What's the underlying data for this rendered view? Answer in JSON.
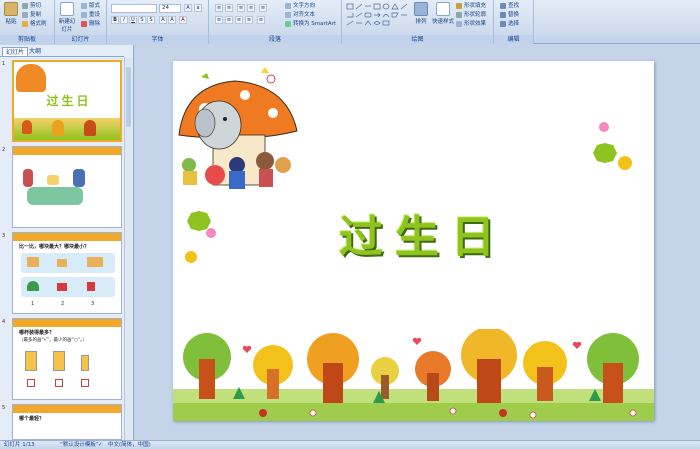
{
  "ribbon": {
    "clipboard": {
      "paste": "粘贴",
      "cut": "剪切",
      "copy": "复制",
      "format_painter": "格式刷",
      "label": "剪贴板"
    },
    "slides": {
      "new_slide": "新建幻灯片",
      "layout": "版式",
      "reset": "重设",
      "delete": "删除",
      "label": "幻灯片"
    },
    "font": {
      "size": "24",
      "label": "字体"
    },
    "paragraph": {
      "text_direction": "文字方向",
      "align_text": "对齐文本",
      "smartart": "转换为 SmartArt",
      "label": "段落"
    },
    "drawing": {
      "arrange": "排列",
      "quick_styles": "快速样式",
      "shape_fill": "形状填充",
      "shape_outline": "形状轮廓",
      "shape_effects": "形状效果",
      "label": "绘图"
    },
    "editing": {
      "find": "查找",
      "replace": "替换",
      "select": "选择",
      "label": "编辑"
    }
  },
  "panel": {
    "tab_slides": "幻灯片",
    "tab_outline": "大纲"
  },
  "thumbnails": [
    {
      "num": "1",
      "title": "过生日"
    },
    {
      "num": "2",
      "title": ""
    },
    {
      "num": "3",
      "title": "比一比，哪块最大？哪块最小？",
      "nums": [
        "1",
        "2",
        "3"
      ]
    },
    {
      "num": "4",
      "title": "哪杯装得最多？",
      "subtitle": "（最多的画“√”，最少的画“○”。）"
    },
    {
      "num": "5",
      "title": "哪个最轻？"
    }
  ],
  "slide": {
    "title": "过生日"
  },
  "status": {
    "slide_count": "幻灯片 1/13",
    "theme": "“默认设计模板”",
    "language": "中文(简体，中国)"
  },
  "colors": {
    "title_green": "#8fc31f",
    "ribbon_blue": "#15428b",
    "accent_orange": "#f2a82b"
  }
}
